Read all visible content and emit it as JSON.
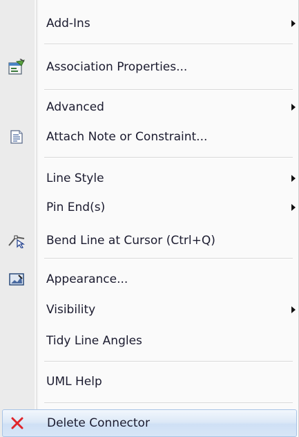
{
  "menu": {
    "items": [
      {
        "label": "Add-Ins",
        "icon": null,
        "submenu": true
      },
      {
        "label": "Association Properties...",
        "icon": "properties-icon",
        "submenu": false
      },
      {
        "label": "Advanced",
        "icon": null,
        "submenu": true
      },
      {
        "label": "Attach Note or Constraint...",
        "icon": "note-icon",
        "submenu": false
      },
      {
        "label": "Line Style",
        "icon": null,
        "submenu": true
      },
      {
        "label": "Pin End(s)",
        "icon": null,
        "submenu": true
      },
      {
        "label": "Bend Line at Cursor (Ctrl+Q)",
        "icon": "bend-line-icon",
        "submenu": false
      },
      {
        "label": "Appearance...",
        "icon": "appearance-icon",
        "submenu": false
      },
      {
        "label": "Visibility",
        "icon": null,
        "submenu": true
      },
      {
        "label": "Tidy Line Angles",
        "icon": null,
        "submenu": false
      },
      {
        "label": "UML Help",
        "icon": null,
        "submenu": false
      },
      {
        "label": "Delete Connector",
        "icon": "delete-icon",
        "submenu": false,
        "highlighted": true
      }
    ]
  },
  "colors": {
    "text": "#1b1b2f",
    "highlight_border": "#a8c4e6",
    "delete_icon": "#e0242a"
  }
}
